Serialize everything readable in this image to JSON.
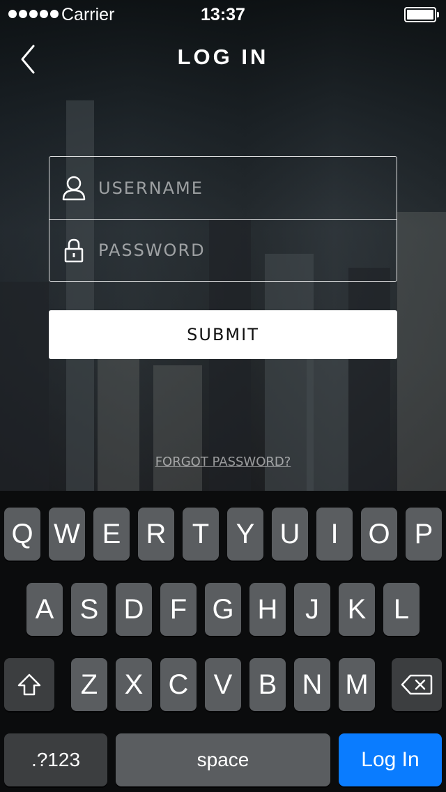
{
  "status_bar": {
    "carrier": "Carrier",
    "time": "13:37"
  },
  "nav": {
    "title": "LOG IN",
    "back_icon": "chevron-left-icon"
  },
  "form": {
    "username": {
      "placeholder": "USERNAME",
      "value": "",
      "icon": "user-icon"
    },
    "password": {
      "placeholder": "PASSWORD",
      "value": "",
      "icon": "lock-icon"
    },
    "submit_label": "SUBMIT",
    "forgot_label": "FORGOT PASSWORD?"
  },
  "keyboard": {
    "row1": [
      "Q",
      "W",
      "E",
      "R",
      "T",
      "Y",
      "U",
      "I",
      "O",
      "P"
    ],
    "row2": [
      "A",
      "S",
      "D",
      "F",
      "G",
      "H",
      "J",
      "K",
      "L"
    ],
    "row3": [
      "Z",
      "X",
      "C",
      "V",
      "B",
      "N",
      "M"
    ],
    "numbers_label": ".?123",
    "space_label": "space",
    "return_label": "Log In",
    "shift_icon": "shift-icon",
    "delete_icon": "delete-icon"
  },
  "colors": {
    "return_key": "#0a7cff",
    "key": "#5a5d60",
    "submit_bg": "#ffffff"
  }
}
